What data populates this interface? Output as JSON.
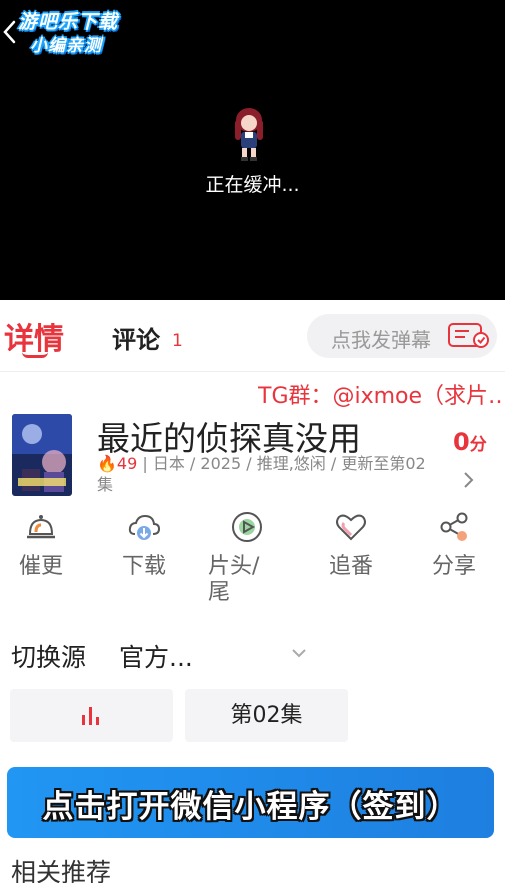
{
  "player": {
    "watermark_line1": "游吧乐下载",
    "watermark_line2": "小编亲测",
    "status_text": "正在缓冲..."
  },
  "tabs": {
    "detail_label": "详情",
    "comments_label": "评论",
    "comments_count": "1",
    "danmaku_placeholder": "点我发弹幕"
  },
  "marquee": {
    "text": "TG群：@ixmoe（求片…"
  },
  "info": {
    "title": "最近的侦探真没用",
    "heat": "49",
    "meta_text": " | 日本 / 2025 / 推理,悠闲 / 更新至第02集",
    "score": "0",
    "score_unit": "分"
  },
  "actions": [
    {
      "label": "催更",
      "icon": "bell-icon"
    },
    {
      "label": "下载",
      "icon": "cloud-download-icon"
    },
    {
      "label": "片头/尾",
      "icon": "play-circle-icon"
    },
    {
      "label": "追番",
      "icon": "heart-icon"
    },
    {
      "label": "分享",
      "icon": "share-icon"
    }
  ],
  "source": {
    "label": "切换源",
    "value": "官方..."
  },
  "episodes": {
    "current_label": "第02集"
  },
  "banner": {
    "text": "点击打开微信小程序（签到）"
  },
  "related": {
    "heading": "相关推荐"
  },
  "colors": {
    "accent": "#e8343c",
    "banner": "#2196f3"
  }
}
